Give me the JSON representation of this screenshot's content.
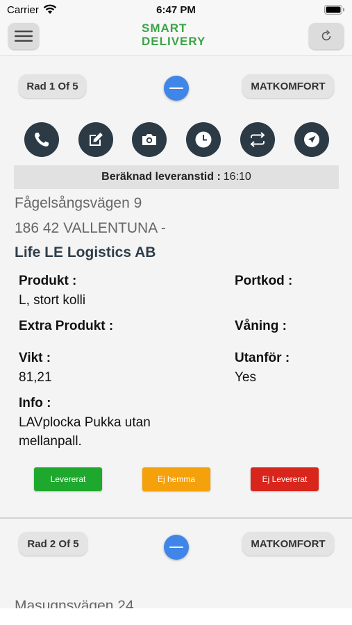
{
  "status_bar": {
    "carrier": "Carrier",
    "time": "6:47 PM"
  },
  "header": {
    "logo_line1": "SMART",
    "logo_line2": "DELIVERY",
    "icons": [
      "menu-icon",
      "refresh-icon"
    ],
    "brand_color": "#3aa447"
  },
  "deliveries": [
    {
      "row_label": "Rad 1 Of 5",
      "customer_tag": "MATKOMFORT",
      "actions": [
        "phone-icon",
        "edit-icon",
        "camera-icon",
        "clock-icon",
        "swap-icon",
        "navigate-icon"
      ],
      "eta_label": "Beräknad leveranstid :",
      "eta_value": "16:10",
      "street": "Fågelsångsvägen 9",
      "postal": "186 42 VALLENTUNA -",
      "company": "Life LE Logistics AB",
      "fields": {
        "produkt_label": "Produkt :",
        "produkt_value": "L, stort kolli",
        "portkod_label": "Portkod :",
        "portkod_value": "",
        "extra_label": "Extra Produkt :",
        "extra_value": "",
        "vaning_label": "Våning :",
        "vaning_value": "",
        "vikt_label": "Vikt :",
        "vikt_value": "81,21",
        "utanfor_label": "Utanför :",
        "utanfor_value": "Yes",
        "info_label": "Info :",
        "info_value_line1": "LAVplocka Pukka utan",
        "info_value_line2": "mellanpall."
      },
      "buttons": {
        "delivered": "Levererat",
        "not_home": "Ej hemma",
        "not_delivered": "Ej Levererat"
      }
    },
    {
      "row_label": "Rad 2 Of 5",
      "customer_tag": "MATKOMFORT",
      "street": "Masugnsvägen 24"
    }
  ],
  "colors": {
    "accent_blue": "#3f86e8",
    "action_dark": "#2b3a45",
    "green": "#1fa82e",
    "orange": "#f5a10c",
    "red": "#d8261c"
  }
}
